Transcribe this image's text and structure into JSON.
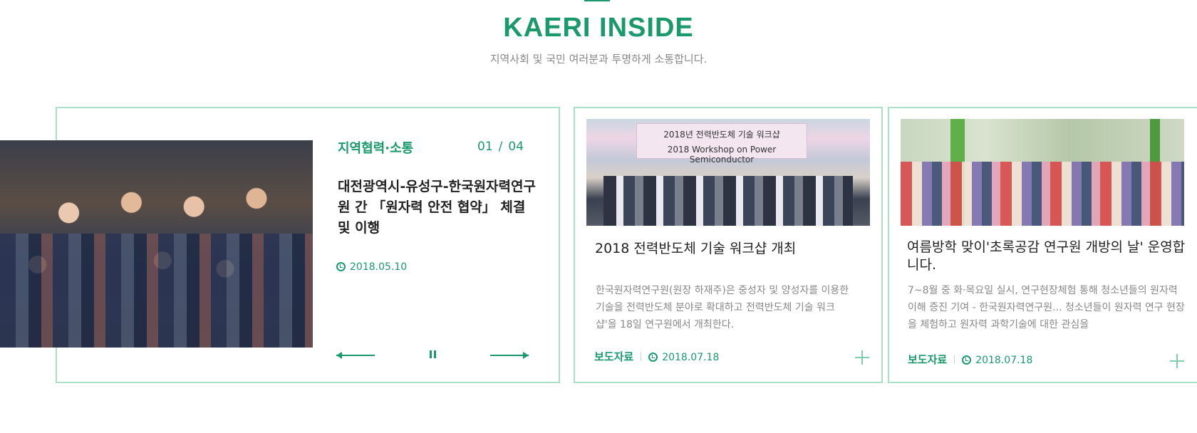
{
  "section": {
    "title": "KAERI INSIDE",
    "subtitle": "지역사회 및 국민 여러분과 투명하게 소통합니다."
  },
  "featured": {
    "category": "지역협력·소통",
    "counter_current": "01",
    "counter_separator": "/",
    "counter_total": "04",
    "title": "대전광역시-유성구-한국원자력연구원 간 「원자력 안전 협약」 체결 및 이행",
    "date": "2018.05.10",
    "controls": {
      "prev_icon": "arrow-left-icon",
      "pause_icon": "pause-icon",
      "next_icon": "arrow-right-icon"
    }
  },
  "cards": [
    {
      "banner_text_line1": "2018년 전력반도체 기술 워크샵",
      "banner_text_line2": "2018 Workshop on Power Semiconductor",
      "title": "2018 전력반도체 기술 워크샵 개최",
      "description": "한국원자력연구원(원장 하재주)은 중성자 및 양성자를 이용한 기술을 전력반도체 분야로 확대하고 전력반도체 기술 워크샵'을 18일 연구원에서 개최한다.",
      "tag": "보도자료",
      "date": "2018.07.18",
      "more_icon": "plus-icon"
    },
    {
      "title": "여름방학 맞이'초록공감 연구원 개방의 날' 운영합니다.",
      "description": "7~8월 중 화·목요일 실시, 연구현장체험 통해 청소년들의 원자력 이해 증진 기여 - 한국원자력연구원... 청소년들이 원자력 연구 현장을 체험하고 원자력 과학기술에 대한 관심을",
      "tag": "보도자료",
      "date": "2018.07.18",
      "more_icon": "plus-icon"
    }
  ],
  "colors": {
    "accent": "#1a9a6c",
    "card_border": "#a8e0c8",
    "muted_text": "#888888"
  }
}
